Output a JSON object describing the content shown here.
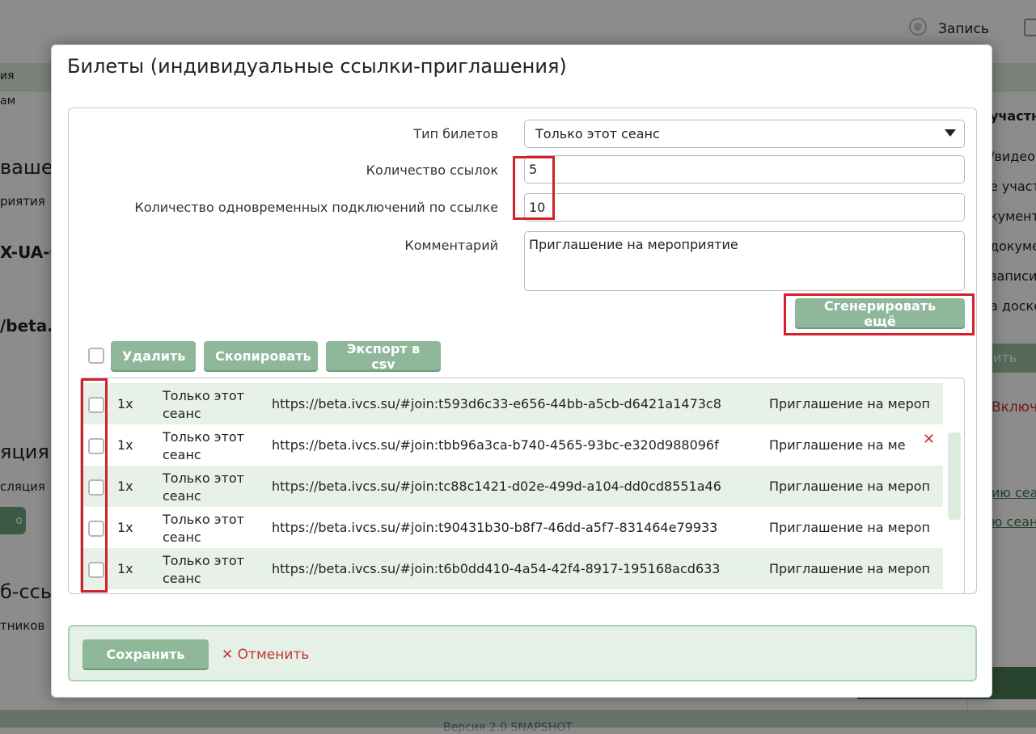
{
  "background": {
    "top_radio_label": "Запись",
    "tab_fragment": "ия",
    "subtab_fragment": "ам",
    "left_heading_1": "ваше",
    "left_sub_1": "риятия",
    "left_code": "X-UA-C",
    "left_url": "/beta.i",
    "left_heading_2": "яция",
    "left_sub_2": "сляция",
    "left_btn": "о",
    "left_heading_3": "б-ссы",
    "left_sub_3": "тников",
    "right_items": [
      "участни",
      "/видео",
      "е участ",
      "кумент",
      "докуме",
      "записи",
      "а доске"
    ],
    "right_btn": "ить из",
    "right_red": "Включ",
    "right_links": [
      "ию сеа",
      "ю сеан"
    ],
    "footer_text": "Версия 2.0 SNAPSHOT"
  },
  "modal": {
    "title": "Билеты (индивидуальные ссылки-приглашения)",
    "form": {
      "ticket_type_label": "Тип билетов",
      "ticket_type_value": "Только этот сеанс",
      "links_count_label": "Количество ссылок",
      "links_count_value": "5",
      "connections_label": "Количество одновременных подключений по ссылке",
      "connections_value": "10",
      "comment_label": "Комментарий",
      "comment_value": "Приглашение на мероприятие"
    },
    "generate_button": "Сгенерировать ещё",
    "actions": {
      "delete": "Удалить",
      "copy": "Скопировать",
      "export": "Экспорт в csv"
    },
    "tickets": [
      {
        "count": "1x",
        "type": "Только этот сеанс",
        "url": "https://beta.ivcs.su/#join:t593d6c33-e656-44bb-a5cb-d6421a1473c8",
        "comment": "Приглашение на мероприятие"
      },
      {
        "count": "1x",
        "type": "Только этот сеанс",
        "url": "https://beta.ivcs.su/#join:tbb96a3ca-b740-4565-93bc-e320d988096f",
        "comment": "Приглашение на мероприятие"
      },
      {
        "count": "1x",
        "type": "Только этот сеанс",
        "url": "https://beta.ivcs.su/#join:tc88c1421-d02e-499d-a104-dd0cd8551a46",
        "comment": "Приглашение на мероприятие"
      },
      {
        "count": "1x",
        "type": "Только этот сеанс",
        "url": "https://beta.ivcs.su/#join:t90431b30-b8f7-46dd-a5f7-831464e79933",
        "comment": "Приглашение на мероприятие"
      },
      {
        "count": "1x",
        "type": "Только этот сеанс",
        "url": "https://beta.ivcs.su/#join:t6b0dd410-4a54-42f4-8917-195168acd633",
        "comment": "Приглашение на мероприятие"
      }
    ],
    "delete_icon": "✕",
    "save_button": "Сохранить",
    "cancel_icon": "✕",
    "cancel_button": "Отменить"
  },
  "colors": {
    "accent": "#8fb79a",
    "highlight": "#d3202a",
    "cancel": "#c43434"
  }
}
